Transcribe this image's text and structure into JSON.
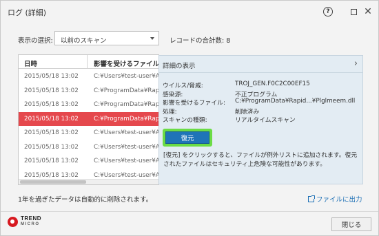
{
  "window": {
    "title": "ログ (詳細)",
    "help_glyph": "?",
    "close_glyph": "✕"
  },
  "filter": {
    "label": "表示の選択:",
    "selected": "以前のスキャン"
  },
  "record_count_text": "レコードの合計数: 8",
  "table": {
    "headers": [
      "日時",
      "影響を受けるファイル"
    ],
    "rows": [
      {
        "date": "2015/05/18 13:02",
        "file": "C:¥Users¥test-user¥App",
        "selected": false
      },
      {
        "date": "2015/05/18 13:02",
        "file": "C:¥ProgramData¥Rapid",
        "selected": false
      },
      {
        "date": "2015/05/18 13:02",
        "file": "C:¥ProgramData¥Rapid",
        "selected": false
      },
      {
        "date": "2015/05/18 13:02",
        "file": "C:¥ProgramData¥Rapid",
        "selected": true
      },
      {
        "date": "2015/05/18 13:02",
        "file": "C:¥Users¥test-user¥App",
        "selected": false
      },
      {
        "date": "2015/05/18 13:02",
        "file": "C:¥Users¥test-user¥App",
        "selected": false
      },
      {
        "date": "2015/05/18 13:02",
        "file": "C:¥Users¥test-user¥App",
        "selected": false
      },
      {
        "date": "2015/05/18 13:02",
        "file": "C:¥Users¥test-user¥App",
        "selected": false
      }
    ]
  },
  "detail": {
    "title": "詳細の表示",
    "chevron": "›",
    "fields": [
      {
        "key": "ウイルス/脅威:",
        "value": "TROJ_GEN.F0C2C00EF15"
      },
      {
        "key": "感染源:",
        "value": "不正プログラム"
      },
      {
        "key": "影響を受けるファイル:",
        "value": "C:¥ProgramData¥Rapid...¥Plglmeem.dll"
      },
      {
        "key": "処理:",
        "value": "削除済み"
      },
      {
        "key": "スキャンの種類:",
        "value": "リアルタイムスキャン"
      }
    ],
    "restore_label": "復元",
    "note": "[復元] をクリックすると、ファイルが例外リストに追加されます。復元されたファイルはセキュリティ上危険な可能性があります。"
  },
  "footer": {
    "note": "1年を過ぎたデータは自動的に削除されます。",
    "export_label": "ファイルに出力",
    "close_label": "閉じる"
  },
  "logo": {
    "line1": "TREND",
    "line2": "MICRO"
  },
  "colors": {
    "selected_row": "#e5484d",
    "restore_button": "#1f74b8",
    "highlight": "#6bdc45",
    "link": "#1c6fb5",
    "brand": "#d71920"
  }
}
